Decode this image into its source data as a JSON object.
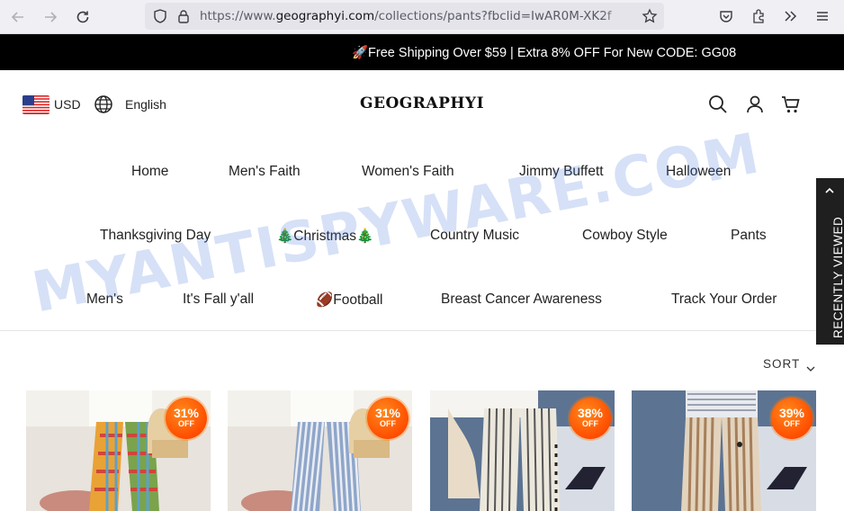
{
  "browser": {
    "url_prefix": "https://www.",
    "url_domain": "geographyi.com",
    "url_path": "/collections/pants?fbclid=IwAR0M-XK2f"
  },
  "promo": {
    "text": "🚀Free Shipping Over $59 | Extra 8% OFF For New CODE: GG08"
  },
  "header": {
    "currency": "USD",
    "language": "English",
    "logo": "GEOGRAPHYI"
  },
  "menu": {
    "row1": [
      "Home",
      "Men's Faith",
      "Women's Faith",
      "Jimmy Buffett",
      "Halloween"
    ],
    "row2": [
      "Thanksgiving Day",
      "🎄Christmas🎄",
      "Country Music",
      "Cowboy Style",
      "Pants"
    ],
    "row3": [
      "Men's",
      "It's Fall y'all",
      "🏈Football",
      "Breast Cancer Awareness",
      "Track Your Order"
    ]
  },
  "sort_label": "SORT",
  "recently_viewed": "RECENTLY VIEWED",
  "products": [
    {
      "discount": "31%",
      "off": "OFF"
    },
    {
      "discount": "31%",
      "off": "OFF"
    },
    {
      "discount": "38%",
      "off": "OFF"
    },
    {
      "discount": "39%",
      "off": "OFF"
    }
  ],
  "watermark": "MYANTISPYWARE.COM",
  "colors": {
    "promo_bg": "#000000",
    "badge": "#ff5a00",
    "recent_tab": "#1f1f1f"
  }
}
